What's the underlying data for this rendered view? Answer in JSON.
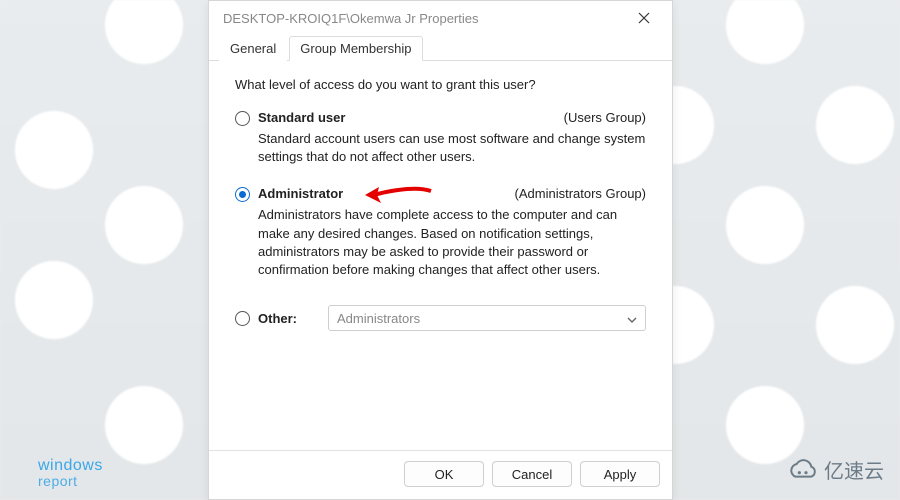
{
  "window": {
    "title": "DESKTOP-KROIQ1F\\Okemwa Jr Properties"
  },
  "tabs": {
    "general": "General",
    "group_membership": "Group Membership",
    "active": "group_membership"
  },
  "content": {
    "prompt": "What level of access do you want to grant this user?",
    "standard": {
      "label": "Standard user",
      "group": "(Users Group)",
      "desc": "Standard account users can use most software and change system settings that do not affect other users."
    },
    "admin": {
      "label": "Administrator",
      "group": "(Administrators Group)",
      "desc": "Administrators have complete access to the computer and can make any desired changes. Based on notification settings, administrators may be asked to provide their password or confirmation before making changes that affect other users."
    },
    "other": {
      "label": "Other:",
      "selected": "Administrators"
    },
    "selected_option": "admin"
  },
  "buttons": {
    "ok": "OK",
    "cancel": "Cancel",
    "apply": "Apply"
  },
  "watermarks": {
    "left_line1": "windows",
    "left_line2": "report",
    "right": "亿速云"
  }
}
